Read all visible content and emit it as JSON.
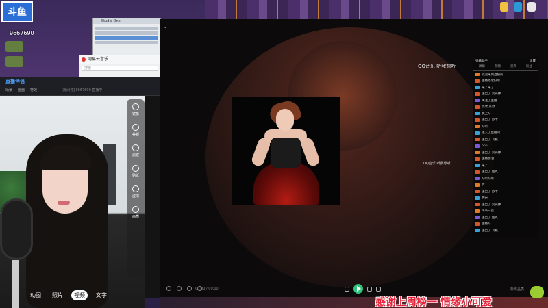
{
  "desktop": {
    "logo_text": "斗鱼",
    "streamer_id": "9667690",
    "accent": "#2b6fd6"
  },
  "audio_window": {
    "title": "Studio One"
  },
  "netease_window": {
    "title": "网易云音乐",
    "search_placeholder": "搜索"
  },
  "obs": {
    "brand": "直播伴侣",
    "tabs": [
      "场景",
      "画面",
      "特效"
    ],
    "info": "[房间号] 9667690 直播中"
  },
  "webcam": {
    "controls": [
      "镜像",
      "美颜",
      "滤镜",
      "贴纸",
      "虚拟",
      "画质"
    ],
    "modes": [
      "动图",
      "照片",
      "视频",
      "文字"
    ],
    "active_mode": "视频"
  },
  "player": {
    "title": "QQ音乐 听我想听",
    "lyric": "QQ音乐 听我想听",
    "time": "00:00 / 00:00",
    "right_text": "标准品质",
    "play_color": "#31c27c"
  },
  "chat": {
    "header_left": "弹幕助手",
    "header_right": "设置",
    "tabs": [
      "弹幕",
      "礼物",
      "贵宾",
      "粉丝"
    ],
    "messages": [
      {
        "badge_color": "#e07a2a",
        "text": "欢迎来到直播间"
      },
      {
        "badge_color": "#d2582a",
        "text": "主播唱歌好听"
      },
      {
        "badge_color": "#3aa0d6",
        "text": "来了来了"
      },
      {
        "badge_color": "#d2582a",
        "text": "送出了 荧光棒"
      },
      {
        "badge_color": "#7a5ad6",
        "text": "关注了主播"
      },
      {
        "badge_color": "#d2582a",
        "text": "点歌 点歌"
      },
      {
        "badge_color": "#3aa0d6",
        "text": "晚上好"
      },
      {
        "badge_color": "#d2582a",
        "text": "送出了 办卡"
      },
      {
        "badge_color": "#e07a2a",
        "text": "好听"
      },
      {
        "badge_color": "#3aa0d6",
        "text": "进入了直播间"
      },
      {
        "badge_color": "#d2582a",
        "text": "送出了 飞机"
      },
      {
        "badge_color": "#7a5ad6",
        "text": "666"
      },
      {
        "badge_color": "#e07a2a",
        "text": "送出了 荧光棒"
      },
      {
        "badge_color": "#d2582a",
        "text": "主播加油"
      },
      {
        "badge_color": "#3aa0d6",
        "text": "来了"
      },
      {
        "badge_color": "#d2582a",
        "text": "送出了 鱼丸"
      },
      {
        "badge_color": "#7a5ad6",
        "text": "好听好听"
      },
      {
        "badge_color": "#e07a2a",
        "text": "赞"
      },
      {
        "badge_color": "#d2582a",
        "text": "送出了 办卡"
      },
      {
        "badge_color": "#3aa0d6",
        "text": "晚安"
      },
      {
        "badge_color": "#d2582a",
        "text": "送出了 荧光棒"
      },
      {
        "badge_color": "#e07a2a",
        "text": "再来一首"
      },
      {
        "badge_color": "#7a5ad6",
        "text": "送出了 鱼丸"
      },
      {
        "badge_color": "#d2582a",
        "text": "主播好"
      },
      {
        "badge_color": "#3aa0d6",
        "text": "送出了 飞机"
      }
    ]
  },
  "ticker": {
    "text": "感谢上周榜一  情缘小可爱"
  }
}
